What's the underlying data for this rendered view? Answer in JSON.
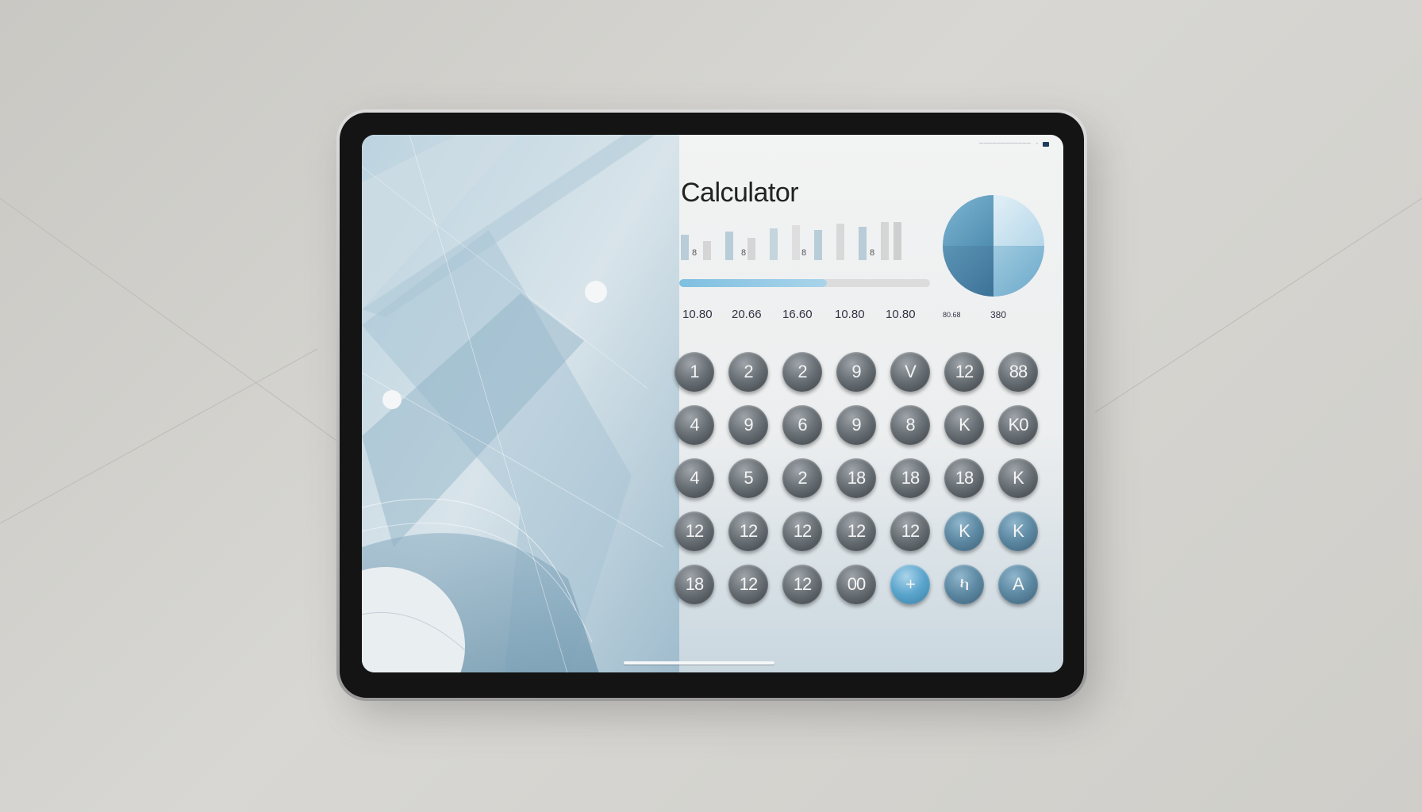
{
  "status_bar": {
    "text": "────────────",
    "tiny": "◦"
  },
  "app": {
    "title": "Calculator"
  },
  "bar_labels": [
    "8",
    "8",
    "8",
    "8"
  ],
  "progress": {
    "fraction": 0.59
  },
  "values": [
    "10.80",
    "20.66",
    "16.60",
    "10.80",
    "10.80",
    "80.68",
    "380"
  ],
  "keypad": {
    "rows": [
      [
        "1",
        "2",
        "2",
        "9",
        "V",
        "12",
        "88"
      ],
      [
        "4",
        "9",
        "6",
        "9",
        "8",
        "K",
        "K0"
      ],
      [
        "4",
        "5",
        "2",
        "18",
        "18",
        "18",
        "K"
      ],
      [
        "12",
        "12",
        "12",
        "12",
        "12",
        "K",
        "K"
      ],
      [
        "18",
        "12",
        "12",
        "00",
        "+",
        "ካ",
        "A"
      ]
    ]
  },
  "colors": {
    "accent": "#7fbfe0",
    "key_dark": "#3a4045",
    "key_blue": "#5d88a2"
  }
}
